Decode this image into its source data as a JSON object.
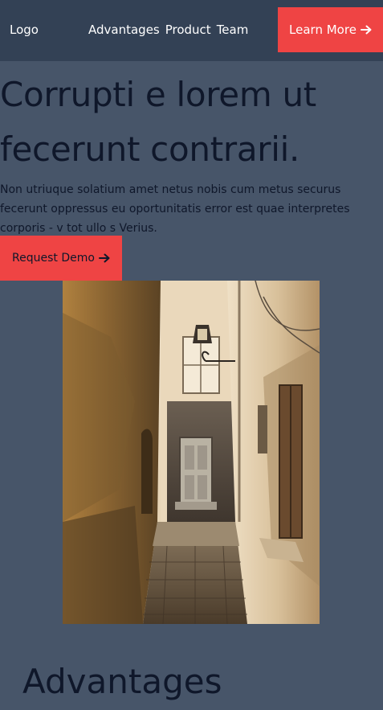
{
  "nav": {
    "logo": "Logo",
    "links": [
      "Advantages",
      "Product",
      "Team"
    ],
    "cta_label": "Learn More",
    "cta_icon": "arrow-right-icon"
  },
  "hero": {
    "title_lines": [
      "Corrupti e lorem ut",
      "fecerunt contrarii."
    ],
    "text_lines": [
      "Non utriuque solatium amet netus nobis cum metus securus",
      "fecerunt oppressus eu oportunitatis error est quae interpretes",
      "corporis - v tot ullo s Verius."
    ],
    "cta_label": "Request Demo",
    "cta_icon": "arrow-right-icon"
  },
  "sections": {
    "advantages_title": "Advantages"
  },
  "colors": {
    "page_bg": "#475569",
    "nav_bg": "#334155",
    "accent": "#ef4444",
    "text_dark": "#0f172a",
    "text_light": "#ffffff"
  }
}
